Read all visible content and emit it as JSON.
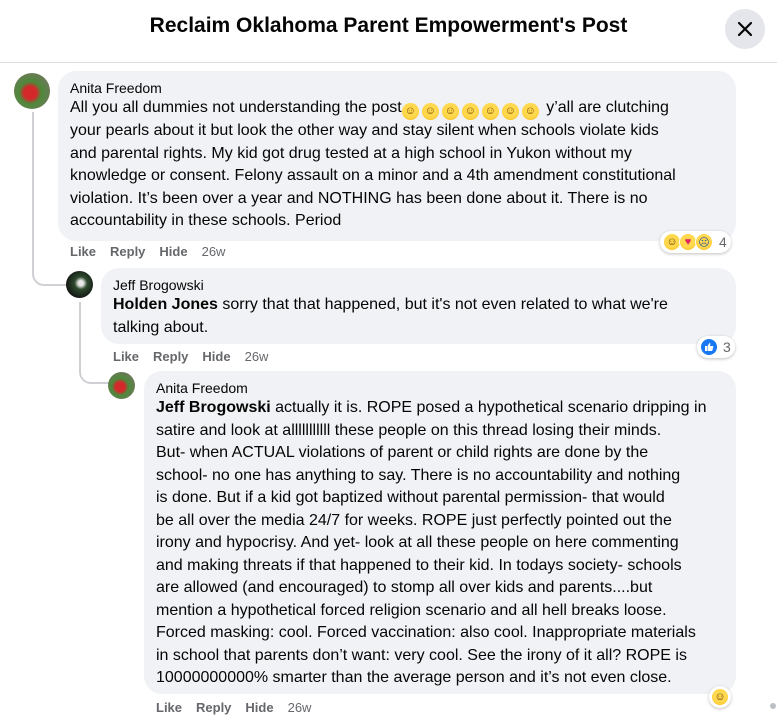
{
  "header": {
    "title": "Reclaim Oklahoma Parent Empowerment's Post"
  },
  "comments": [
    {
      "author": "Anita Freedom",
      "text_before_emoji": "All you all dummies not understanding the post",
      "emoji_count": 7,
      "text_lines": [
        " y’all are clutching",
        "your pearls about it but look the other way and stay silent when schools violate kids",
        "and parental rights. My kid got drug tested at a high school in Yukon without my",
        "knowledge or consent. Felony assault on a minor and a 4th amendment constitutional",
        "violation. It’s been over a year and NOTHING has been done about it. There is no",
        "accountability in these schools. Period"
      ],
      "actions": {
        "like": "Like",
        "reply": "Reply",
        "hide": "Hide",
        "time": "26w"
      },
      "reaction_icons": [
        "haha",
        "care",
        "sad"
      ],
      "reaction_count": "4"
    },
    {
      "author": "Jeff Brogowski",
      "mention": "Holden Jones",
      "text_lines": [
        " sorry that that happened, but it's not even related to what we're",
        "talking about."
      ],
      "actions": {
        "like": "Like",
        "reply": "Reply",
        "hide": "Hide",
        "time": "26w"
      },
      "reaction_icons": [
        "like"
      ],
      "reaction_count": "3"
    },
    {
      "author": "Anita Freedom",
      "mention": "Jeff Brogowski",
      "text_lines": [
        " actually it is. ROPE posed a hypothetical scenario dripping in",
        "satire and look at alllllllllll these people on this thread losing their minds.",
        "But- when ACTUAL violations of parent or child rights are done by the",
        "school- no one has anything to say. There is no accountability and nothing",
        "is done. But if a kid got baptized without parental permission- that would",
        "be all over the media 24/7 for weeks. ROPE just perfectly pointed out the",
        "irony and hypocrisy. And yet- look at all these people on here commenting",
        "and making threats if that happened to their kid. In todays society- schools",
        "are allowed (and encouraged) to stomp all over kids and parents....but",
        "mention a hypothetical forced religion scenario and all hell breaks loose.",
        "Forced masking: cool. Forced vaccination: also cool. Inappropriate materials",
        "in school that parents don’t want: very cool. See the irony of it all? ROPE is",
        "10000000000% smarter than the average person and it’s not even close."
      ],
      "actions": {
        "like": "Like",
        "reply": "Reply",
        "hide": "Hide",
        "time": "26w"
      },
      "reaction_icons": [
        "haha"
      ]
    }
  ],
  "icons": {
    "close": "close-icon",
    "haha": "haha-reaction-icon",
    "care": "care-reaction-icon",
    "sad": "sad-reaction-icon",
    "like": "like-reaction-icon"
  },
  "colors": {
    "bubble": "#f0f2f5",
    "meta": "#65676b",
    "like_blue": "#1877f2",
    "close_bg": "#e4e6eb"
  }
}
